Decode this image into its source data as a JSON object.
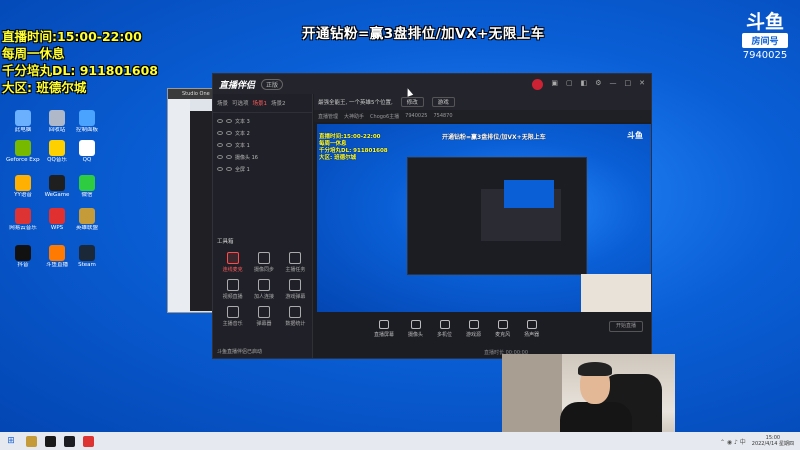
{
  "overlay": {
    "stream_time": "直播时间:15:00-22:00",
    "rest_day": "每周一休息",
    "dl_line": "千分培丸DL: 911801608",
    "region": "大区: 班德尔城",
    "banner": "开通钻粉=赢3盘排位/加VX+无限上车"
  },
  "douyu": {
    "mark": "斗鱼",
    "tag": "房间号",
    "room": "7940025"
  },
  "desktop_icons": [
    {
      "label": "此电脑",
      "color": "#6ab0ff"
    },
    {
      "label": "回收站",
      "color": "#aeb8c8"
    },
    {
      "label": "控制面板",
      "color": "#4aa3ff"
    },
    {
      "label": "Geforce Experience",
      "color": "#76b900"
    },
    {
      "label": "QQ音乐",
      "color": "#ffd000"
    },
    {
      "label": "QQ",
      "color": "#ffffff"
    },
    {
      "label": "YY语音",
      "color": "#ffb000"
    },
    {
      "label": "WeGame",
      "color": "#1f1f1f"
    },
    {
      "label": "微信",
      "color": "#2ecc40"
    },
    {
      "label": "网易云音乐",
      "color": "#d33"
    },
    {
      "label": "WPS",
      "color": "#e03030"
    },
    {
      "label": "英雄联盟",
      "color": "#c59b3a"
    },
    {
      "label": "抖音",
      "color": "#111"
    },
    {
      "label": "斗鱼直播",
      "color": "#ff7a00"
    },
    {
      "label": "Steam",
      "color": "#1b2838"
    }
  ],
  "studio_window": {
    "title": "Studio One"
  },
  "main_window": {
    "brand": "直播伴侣",
    "version": "正版",
    "scene_tabs": [
      "场景",
      "可选项",
      "场景1",
      "场景2"
    ],
    "sources": [
      "文本 3",
      "文本 2",
      "文本 1",
      "摄像头 16",
      "全屏 1"
    ],
    "toolbox_title": "工具箱",
    "tools": [
      "连线麦克",
      "摄像同步",
      "主播任务",
      "视频直播",
      "加人连接",
      "游戏弹幕",
      "主播音乐",
      "弹幕器",
      "数据统计"
    ],
    "top_title": "最强全能王, 一个英雄5个位置,",
    "top_pill1": "修改",
    "top_pill2": "游戏",
    "sub_items": [
      "直播管理",
      "大神助手",
      "Chogo6主播",
      "7940025",
      "754870"
    ],
    "bottom_buttons": [
      "直播屏幕",
      "摄像头",
      "多机位",
      "游戏源",
      "麦克风",
      "扬声器"
    ],
    "go_live": "开始直播",
    "status_left": "斗鱼直播伴侣已启动",
    "status_right": "直播时长 00:00:00"
  },
  "preview": {
    "info": [
      "直播时间:15:00-22:00",
      "每周一休息",
      "千分培丸DL: 911801608",
      "大区: 班德尔城"
    ],
    "banner": "开通钻粉=赢3盘排位/加VX+无限上车",
    "logo": "斗鱼"
  },
  "taskbar": {
    "time": "15:00",
    "date": "2022/4/14 星期四"
  }
}
